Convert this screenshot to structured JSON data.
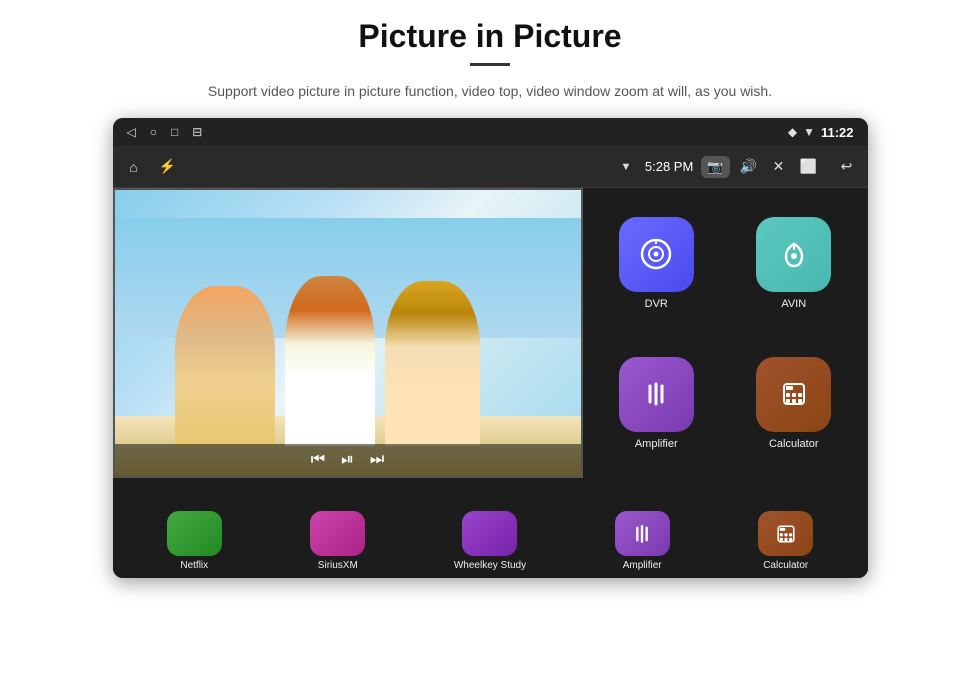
{
  "header": {
    "title": "Picture in Picture",
    "divider": true,
    "description": "Support video picture in picture function, video top, video window zoom at will, as you wish."
  },
  "statusBar": {
    "leftIcons": [
      "back",
      "home",
      "square",
      "bookmark"
    ],
    "rightIcons": [
      "location",
      "wifi"
    ],
    "time": "11:22"
  },
  "toolbar": {
    "homeIcon": "🏠",
    "usbIcon": "⚡",
    "wifiSignal": "▼",
    "time": "5:28 PM",
    "cameraIcon": "📷",
    "volumeIcon": "🔊",
    "closeIcon": "✕",
    "windowIcon": "⬜",
    "backIcon": "↩"
  },
  "videoOverlay": {
    "cameraIcon": "📷",
    "minusLabel": "−",
    "plusLabel": "+",
    "closeLabel": "✕",
    "prevIcon": "⏮",
    "playIcon": "⏯",
    "nextIcon": "⏭"
  },
  "apps": {
    "grid": [
      {
        "id": "dvr",
        "label": "DVR",
        "icon": "dvr",
        "colorClass": "app-icon-dvr"
      },
      {
        "id": "avin",
        "label": "AVIN",
        "icon": "avin",
        "colorClass": "app-icon-avin"
      },
      {
        "id": "amplifier",
        "label": "Amplifier",
        "icon": "amplifier",
        "colorClass": "app-icon-amplifier"
      },
      {
        "id": "calculator",
        "label": "Calculator",
        "icon": "calculator",
        "colorClass": "app-icon-calculator"
      }
    ],
    "bottomRow": [
      {
        "id": "netflix",
        "label": "Netflix",
        "colorClass": "bottom-app-netflix"
      },
      {
        "id": "siriusxm",
        "label": "SiriusXM",
        "colorClass": "bottom-app-sirius"
      },
      {
        "id": "wheelkey",
        "label": "Wheelkey Study",
        "colorClass": "bottom-app-wheelkey"
      },
      {
        "id": "amplifier-bottom",
        "label": "Amplifier"
      },
      {
        "id": "calculator-bottom",
        "label": "Calculator"
      }
    ]
  }
}
